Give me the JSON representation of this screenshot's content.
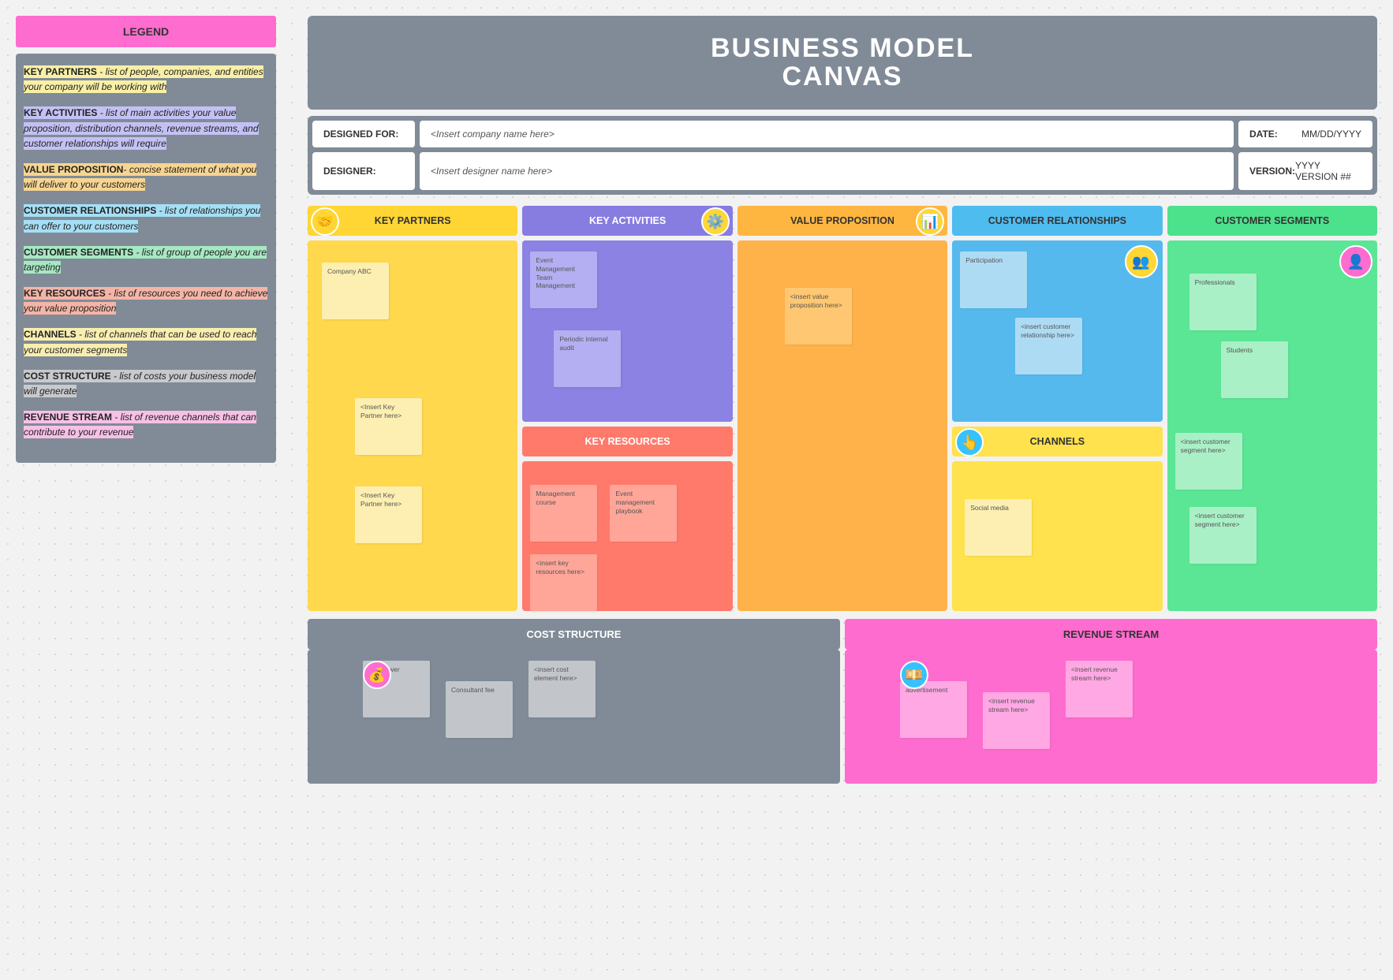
{
  "legend": {
    "header": "LEGEND",
    "items": [
      {
        "term": "KEY PARTNERS",
        "sep": " - ",
        "desc": "list of people, companies, and entities your company will be working with"
      },
      {
        "term": "KEY ACTIVITIES",
        "sep": " - ",
        "desc": "list of main activities your value proposition, distribution channels, revenue streams, and customer relationships will require"
      },
      {
        "term": "VALUE PROPOSITION",
        "sep": "- ",
        "desc": "concise statement of what you will deliver to your customers"
      },
      {
        "term": "CUSTOMER RELATIONSHIPS",
        "sep": " - ",
        "desc": "list of relationships you can offer to your customers"
      },
      {
        "term": "CUSTOMER SEGMENTS",
        "sep": " - ",
        "desc": "list of group of people you are targeting"
      },
      {
        "term": "KEY RESOURCES",
        "sep": " - ",
        "desc": "list of resources you need to achieve your value proposition"
      },
      {
        "term": "CHANNELS",
        "sep": " - ",
        "desc": "list of channels that can be used to reach your customer segments"
      },
      {
        "term": "COST STRUCTURE",
        "sep": " - ",
        "desc": "list of costs your business model will generate"
      },
      {
        "term": "REVENUE STREAM",
        "sep": " - ",
        "desc": "list of revenue channels that can contribute to your revenue"
      }
    ]
  },
  "title_line1": "BUSINESS MODEL",
  "title_line2": "CANVAS",
  "meta": {
    "designed_for_label": "DESIGNED FOR:",
    "designed_for_value": "<Insert company name here>",
    "date_label": "DATE:",
    "date_value": "MM/DD/YYYY",
    "designer_label": "DESIGNER:",
    "designer_value": "<Insert designer name here>",
    "version_label": "VERSION:",
    "version_value": "YYYY VERSION ##"
  },
  "sections": {
    "key_partners": {
      "label": "KEY PARTNERS",
      "notes": [
        "Company ABC",
        "<Insert Key Partner here>",
        "<Insert Key Partner here>"
      ]
    },
    "key_activities": {
      "label": "KEY ACTIVITIES",
      "notes": [
        "Event Management Team Management",
        "Periodic internal audit"
      ]
    },
    "value_proposition": {
      "label": "VALUE PROPOSITION",
      "notes": [
        "<insert value proposition here>"
      ]
    },
    "customer_relationships": {
      "label": "CUSTOMER RELATIONSHIPS",
      "notes": [
        "Participation",
        "<insert customer relationship here>"
      ]
    },
    "customer_segments": {
      "label": "CUSTOMER SEGMENTS",
      "notes": [
        "Professionals",
        "Students",
        "<insert customer segment here>",
        "<insert customer segment here>"
      ]
    },
    "key_resources": {
      "label": "KEY RESOURCES",
      "notes": [
        "Management course",
        "Event management playbook",
        "<insert key resources here>"
      ]
    },
    "channels": {
      "label": "CHANNELS",
      "notes": [
        "Social media"
      ]
    },
    "cost_structure": {
      "label": "COST STRUCTURE",
      "notes": [
        "Manpower",
        "Consultant fee",
        "<insert cost element here>"
      ]
    },
    "revenue_stream": {
      "label": "REVENUE STREAM",
      "notes": [
        "advertisement",
        "<insert revenue stream here>",
        "<insert revenue stream here>"
      ]
    }
  }
}
